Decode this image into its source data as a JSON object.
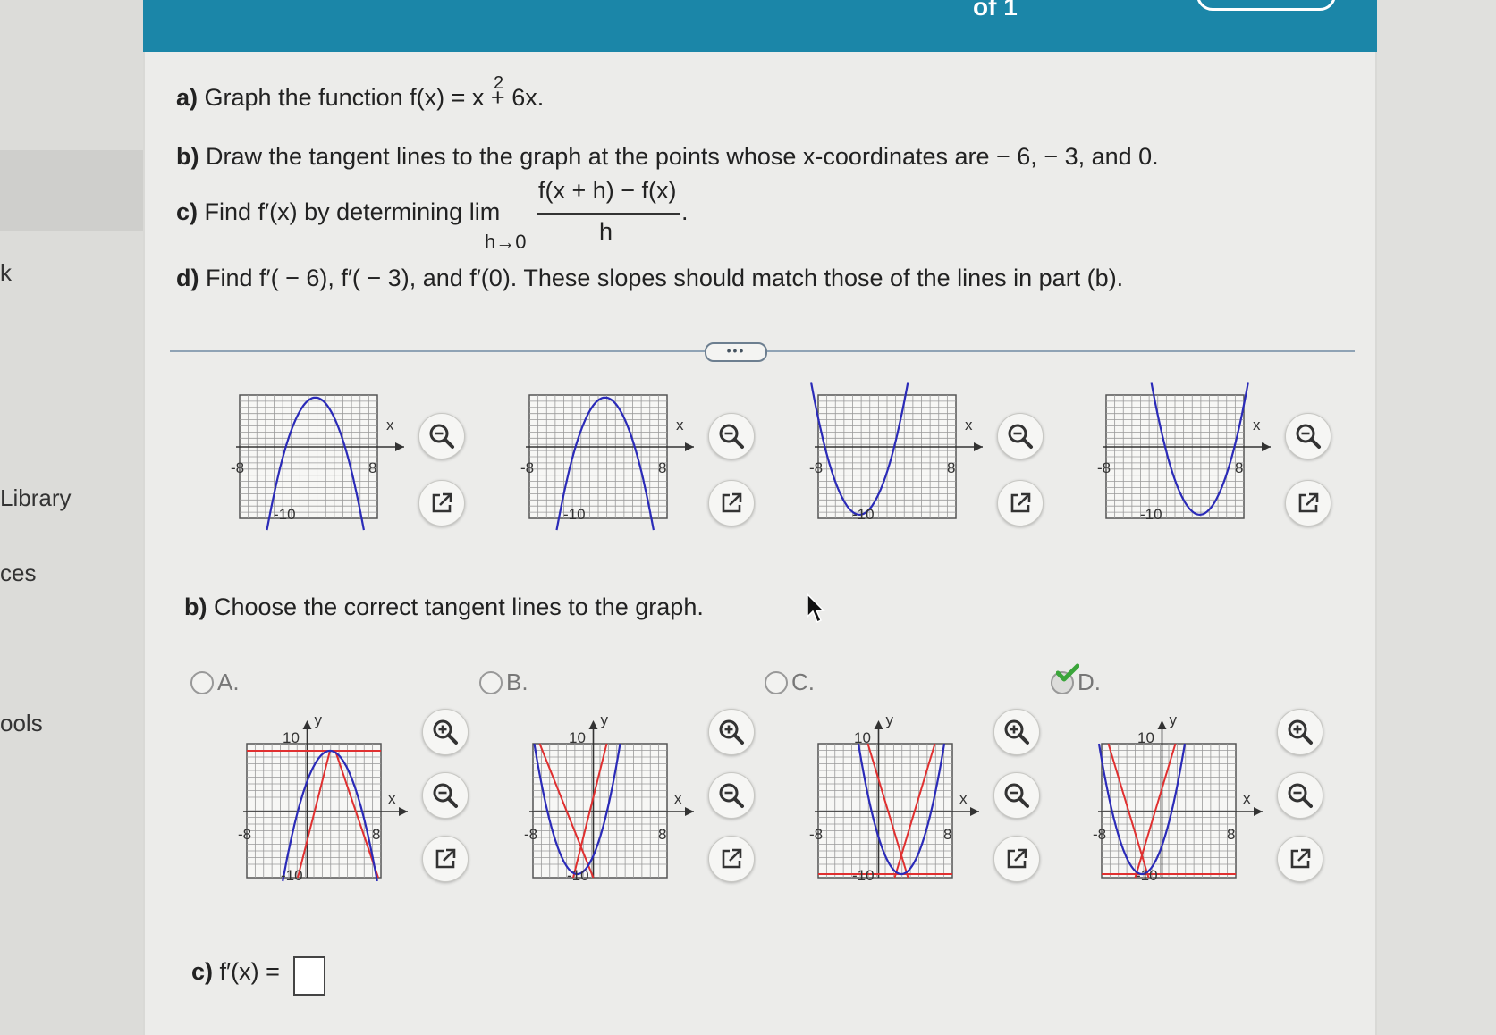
{
  "header": {
    "page_indicator": "of 1"
  },
  "sidebar": {
    "items": [
      {
        "label": "k"
      },
      {
        "label": "Library"
      },
      {
        "label": "ces"
      },
      {
        "label": "ools"
      }
    ]
  },
  "question": {
    "a_label": "a)",
    "a_text": "Graph the function f(x) = x + 6x.",
    "a_exponent": "2",
    "b_label": "b)",
    "b_text": "Draw the tangent lines to the graph at the points whose x-coordinates are − 6, − 3, and 0.",
    "c_label": "c)",
    "c_text": "Find f′(x) by determining  lim",
    "c_lim_sub": "h→0",
    "c_numerator": "f(x + h) − f(x)",
    "c_denominator": "h",
    "c_period": ".",
    "d_label": "d)",
    "d_text": "Find f′( − 6), f′( − 3), and f′(0). These slopes should match those of the lines in part (b)."
  },
  "expand_dots": "•••",
  "part_a_graphs": [
    {
      "shape": "down",
      "x_label": "x",
      "x_min_label": "-8",
      "x_max_label": "8",
      "y_min_label": "-10"
    },
    {
      "shape": "down",
      "x_label": "x",
      "x_min_label": "-8",
      "x_max_label": "8",
      "y_min_label": "-10"
    },
    {
      "shape": "up",
      "x_label": "x",
      "x_min_label": "-8",
      "x_max_label": "8",
      "y_min_label": "-10"
    },
    {
      "shape": "up",
      "x_label": "x",
      "x_min_label": "-8",
      "x_max_label": "8",
      "y_min_label": "-10"
    }
  ],
  "part_b": {
    "prompt_label": "b)",
    "prompt_text": "Choose the correct tangent lines to the graph.",
    "options": [
      {
        "letter": "A.",
        "selected": false,
        "correct_mark": false,
        "y_label": "y",
        "y_max_label": "10",
        "x_label": "x",
        "x_min_label": "-8",
        "x_max_label": "8",
        "y_min_label": "-10"
      },
      {
        "letter": "B.",
        "selected": false,
        "correct_mark": false,
        "y_label": "y",
        "y_max_label": "10",
        "x_label": "x",
        "x_min_label": "-8",
        "x_max_label": "8",
        "y_min_label": "-10"
      },
      {
        "letter": "C.",
        "selected": false,
        "correct_mark": false,
        "y_label": "y",
        "y_max_label": "10",
        "x_label": "x",
        "x_min_label": "-8",
        "x_max_label": "8",
        "y_min_label": "-10"
      },
      {
        "letter": "D.",
        "selected": true,
        "correct_mark": true,
        "y_label": "y",
        "y_max_label": "10",
        "x_label": "x",
        "x_min_label": "-8",
        "x_max_label": "8",
        "y_min_label": "-10"
      }
    ]
  },
  "part_c": {
    "label": "c)",
    "text": "f′(x) =",
    "answer_value": ""
  },
  "colors": {
    "header": "#1b86a8",
    "curve": "#2b2bb8",
    "tangent": "#e03030",
    "check": "#3aa53a"
  }
}
